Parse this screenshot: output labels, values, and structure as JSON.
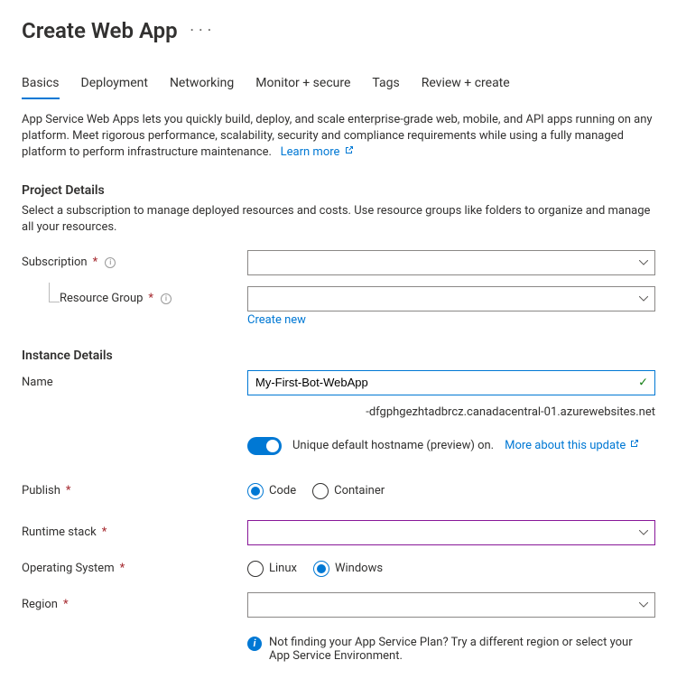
{
  "page_title": "Create Web App",
  "tabs": [
    "Basics",
    "Deployment",
    "Networking",
    "Monitor + secure",
    "Tags",
    "Review + create"
  ],
  "active_tab": "Basics",
  "intro": "App Service Web Apps lets you quickly build, deploy, and scale enterprise-grade web, mobile, and API apps running on any platform. Meet rigorous performance, scalability, security and compliance requirements while using a fully managed platform to perform infrastructure maintenance.",
  "intro_link": "Learn more",
  "project_details": {
    "heading": "Project Details",
    "desc": "Select a subscription to manage deployed resources and costs. Use resource groups like folders to organize and manage all your resources.",
    "subscription_label": "Subscription",
    "resource_group_label": "Resource Group",
    "create_new": "Create new"
  },
  "instance": {
    "heading": "Instance Details",
    "name_label": "Name",
    "name_value": "My-First-Bot-WebApp",
    "domain_suffix": "-dfgphgezhtadbrcz.canadacentral-01.azurewebsites.net",
    "toggle_label": "Unique default hostname (preview) on.",
    "toggle_link": "More about this update",
    "publish_label": "Publish",
    "publish_options": [
      "Code",
      "Container"
    ],
    "publish_selected": "Code",
    "runtime_label": "Runtime stack",
    "os_label": "Operating System",
    "os_options": [
      "Linux",
      "Windows"
    ],
    "os_selected": "Windows",
    "region_label": "Region",
    "region_note": "Not finding your App Service Plan? Try a different region or select your App Service Environment."
  }
}
